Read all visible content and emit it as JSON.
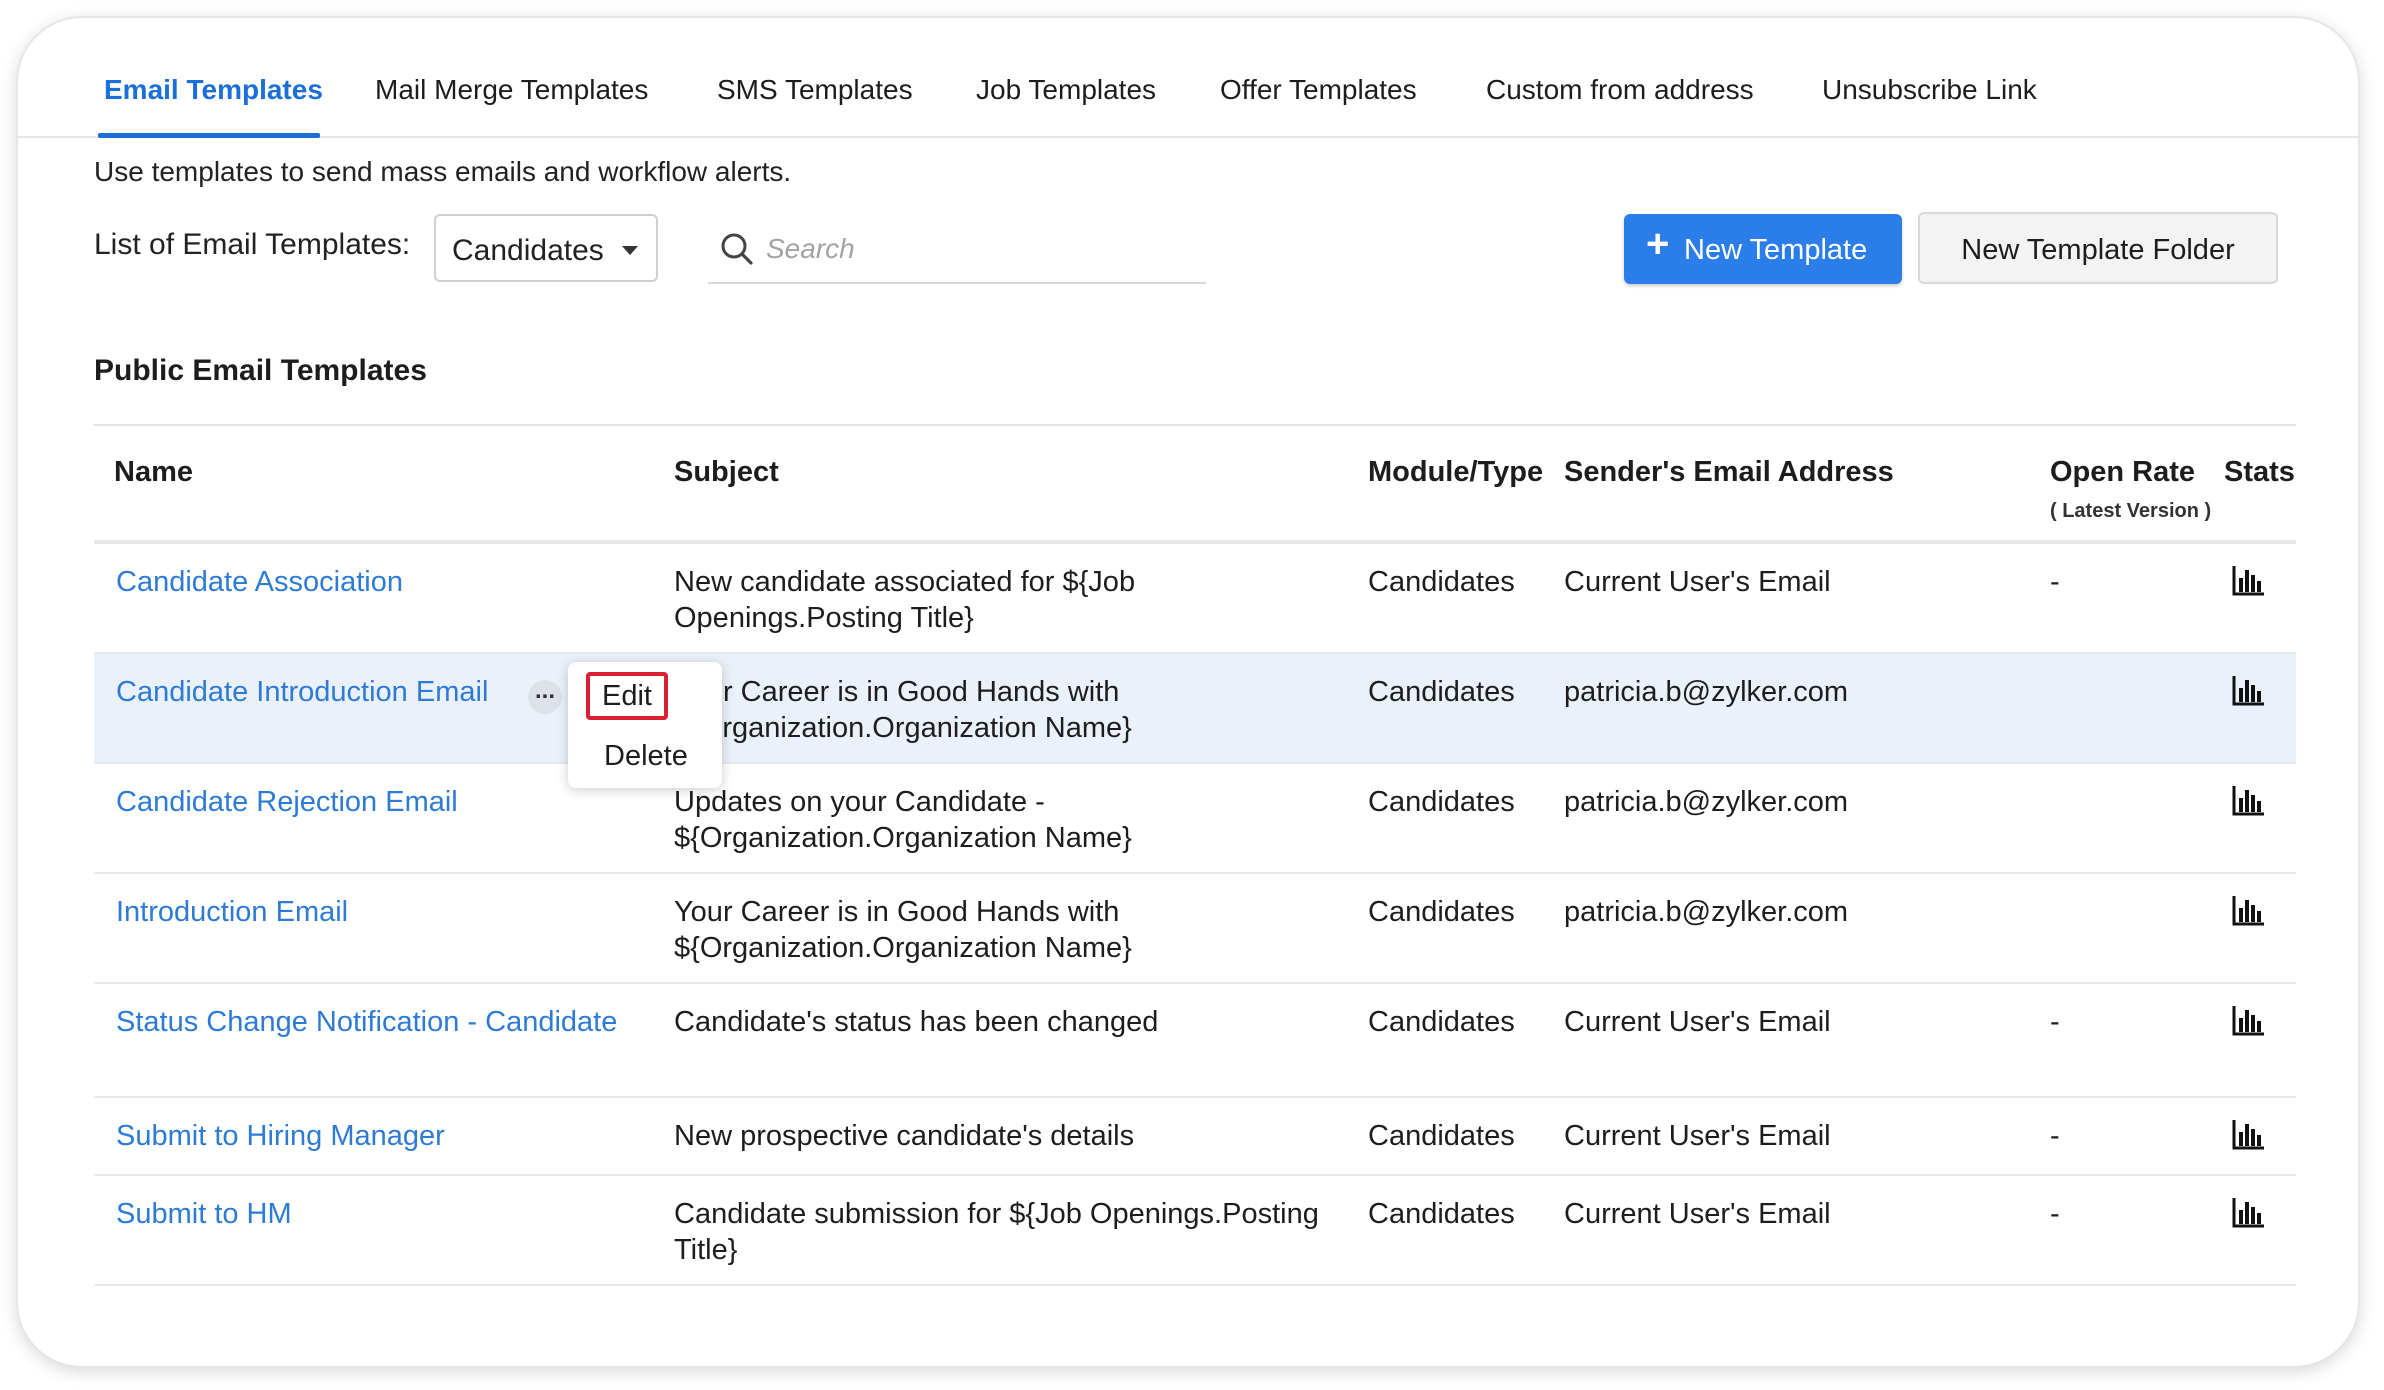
{
  "tabs": [
    {
      "label": "Email Templates",
      "active": true
    },
    {
      "label": "Mail Merge Templates"
    },
    {
      "label": "SMS Templates"
    },
    {
      "label": "Job Templates"
    },
    {
      "label": "Offer Templates"
    },
    {
      "label": "Custom from address"
    },
    {
      "label": "Unsubscribe Link"
    }
  ],
  "intro_text": "Use templates to send mass emails and workflow alerts.",
  "filter": {
    "label": "List of Email Templates:",
    "selected": "Candidates"
  },
  "search": {
    "placeholder": "Search",
    "value": ""
  },
  "buttons": {
    "new_template": "New Template",
    "new_template_folder": "New Template Folder"
  },
  "section_title": "Public Email Templates",
  "columns": {
    "name": "Name",
    "subject": "Subject",
    "module": "Module/Type",
    "sender": "Sender's Email Address",
    "open_rate": "Open Rate",
    "open_rate_sub": "( Latest Version )",
    "stats": "Stats"
  },
  "rows": [
    {
      "name": "Candidate Association",
      "subject": "New candidate associated for ${Job Openings.Posting Title}",
      "module": "Candidates",
      "sender": "Current User's Email",
      "open_rate": "-"
    },
    {
      "name": "Candidate Introduction Email",
      "subject": "Your Career is in Good Hands with ${Organization.Organization Name}",
      "module": "Candidates",
      "sender": "patricia.b@zylker.com",
      "open_rate": ""
    },
    {
      "name": "Candidate Rejection Email",
      "subject": "Updates on your Candidate - ${Organization.Organization Name}",
      "module": "Candidates",
      "sender": "patricia.b@zylker.com",
      "open_rate": ""
    },
    {
      "name": "Introduction Email",
      "subject": "Your Career is in Good Hands with ${Organization.Organization Name}",
      "module": "Candidates",
      "sender": "patricia.b@zylker.com",
      "open_rate": ""
    },
    {
      "name": "Status Change Notification - Candidate",
      "subject": "Candidate's status has been changed",
      "module": "Candidates",
      "sender": "Current User's Email",
      "open_rate": "-"
    },
    {
      "name": "Submit to Hiring Manager",
      "subject": "New prospective candidate's details",
      "module": "Candidates",
      "sender": "Current User's Email",
      "open_rate": "-"
    },
    {
      "name": "Submit to HM",
      "subject": "Candidate submission for ${Job Openings.Posting Title}",
      "module": "Candidates",
      "sender": "Current User's Email",
      "open_rate": "-"
    }
  ],
  "context_menu": {
    "edit": "Edit",
    "delete": "Delete"
  },
  "more_glyph": "...",
  "colors": {
    "accent": "#1a6fd8",
    "link": "#2d7bd6",
    "primary_button": "#2b7de9",
    "highlight_row": "#ebf1fa",
    "edit_outline": "#d92034"
  },
  "icons": [
    "search-icon",
    "plus-icon",
    "caret-down-icon",
    "bar-chart-icon",
    "more-options-icon"
  ]
}
